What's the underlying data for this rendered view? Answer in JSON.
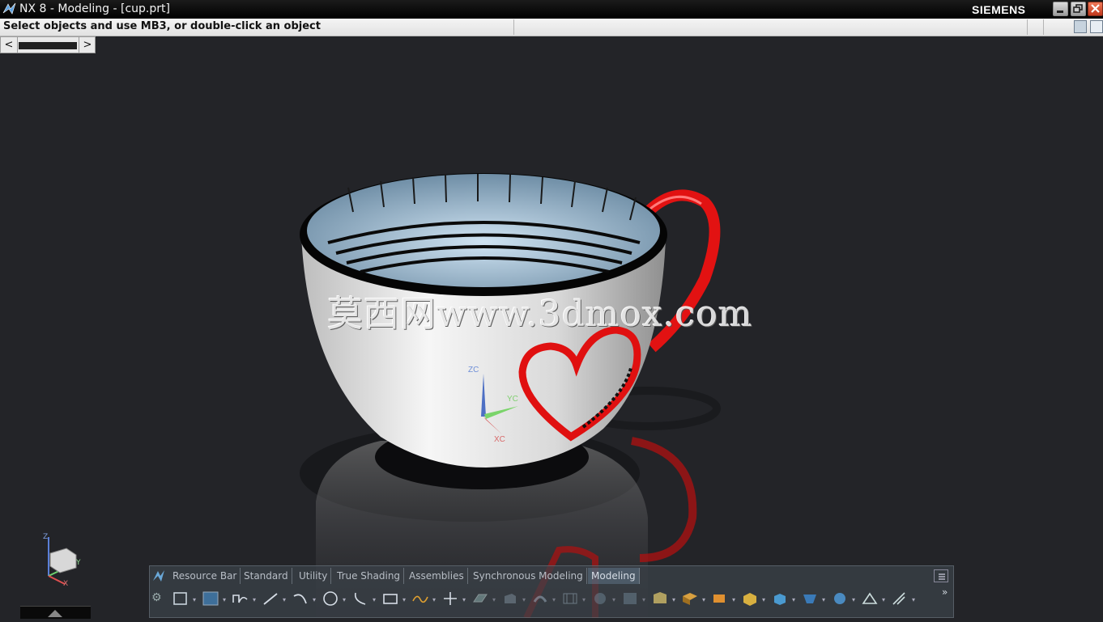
{
  "window": {
    "title": "NX 8 - Modeling - [cup.prt]",
    "brand": "SIEMENS",
    "controls": [
      "minimize-icon",
      "restore-icon",
      "close-icon"
    ]
  },
  "status": {
    "prompt": "Select objects and use MB3, or double-click an object"
  },
  "nav": {
    "prev": "<",
    "next": ">"
  },
  "viewport": {
    "background": "#232428",
    "watermark": "莫西网www.3dmox.com",
    "csys": {
      "z": "ZC",
      "y": "YC",
      "x": "XC"
    },
    "triad": {
      "z": "Z",
      "y": "Y",
      "x": "X"
    },
    "cup_color": "#e9e9e9",
    "heart_color": "#e01010"
  },
  "dock": {
    "tabs": [
      {
        "label": "Resource Bar",
        "active": false
      },
      {
        "label": "Standard",
        "active": false
      },
      {
        "label": "Utility",
        "active": false
      },
      {
        "label": "True Shading",
        "active": false
      },
      {
        "label": "Assemblies",
        "active": false
      },
      {
        "label": "Synchronous Modeling",
        "active": false
      },
      {
        "label": "Modeling",
        "active": true
      }
    ],
    "more": "»",
    "tools": [
      "sketch-icon",
      "sketch-in-task-icon",
      "profile-icon",
      "line-icon",
      "arc-icon",
      "circle-icon",
      "curve-icon",
      "rectangle-icon",
      "studio-spline-icon",
      "point-icon",
      "datum-plane-icon",
      "extrude-icon",
      "revolve-icon",
      "hole-icon",
      "boss-icon",
      "pocket-icon",
      "pad-icon",
      "slot-icon",
      "groove-icon",
      "block-icon",
      "cylinder-icon",
      "cone-icon",
      "sphere-icon",
      "edge-blend-icon",
      "chamfer-icon"
    ]
  }
}
